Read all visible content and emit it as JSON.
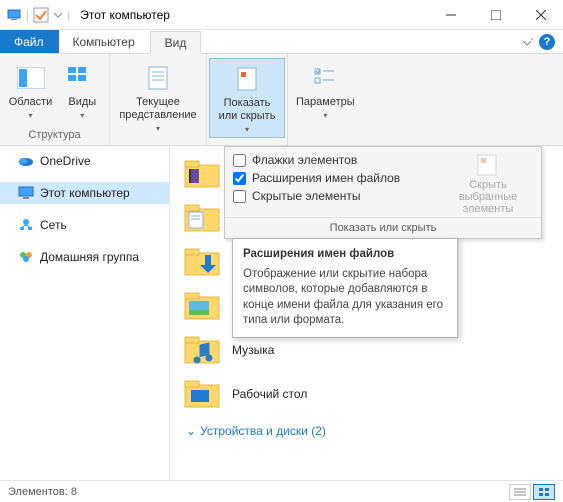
{
  "title": "Этот компьютер",
  "tabs": {
    "file": "Файл",
    "computer": "Компьютер",
    "view": "Вид"
  },
  "ribbon": {
    "panes": {
      "label": "Области",
      "group": ""
    },
    "views": {
      "label": "Виды",
      "group": "Структура"
    },
    "current": {
      "label": "Текущее\nпредставление"
    },
    "showhide": {
      "label": "Показать\nили скрыть"
    },
    "params": {
      "label": "Параметры"
    }
  },
  "showhide_panel": {
    "check_flags": "Флажки элементов",
    "check_ext": "Расширения имен файлов",
    "check_hidden": "Скрытые элементы",
    "right_label": "Скрыть выбранные\nэлементы",
    "footer": "Показать или скрыть",
    "ext_checked": true,
    "flags_checked": false,
    "hidden_checked": false
  },
  "tooltip": {
    "title": "Расширения имен файлов",
    "body": "Отображение или скрытие набора символов, которые добавляются в конце имени файла для указания его типа или формата."
  },
  "nav": {
    "onedrive": "OneDrive",
    "thispc": "Этот компьютер",
    "network": "Сеть",
    "homegroup": "Домашняя группа"
  },
  "items": {
    "music": "Музыка",
    "desktop": "Рабочий стол"
  },
  "section": "Устройства и диски (2)",
  "status": "Элементов: 8"
}
